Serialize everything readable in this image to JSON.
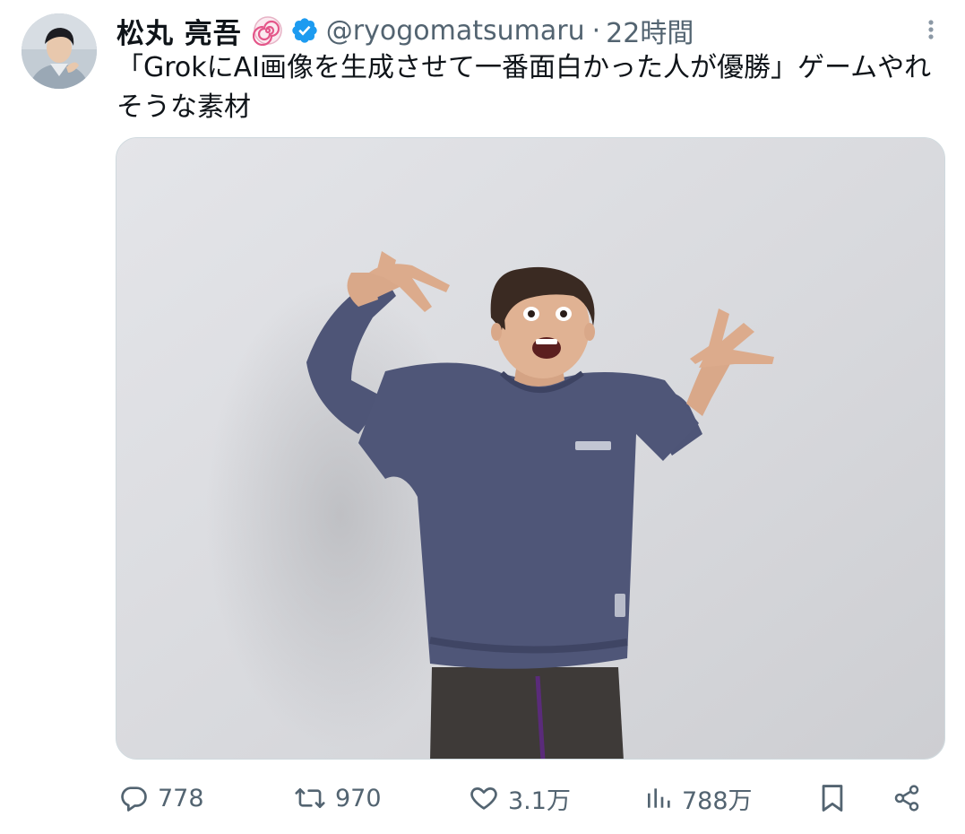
{
  "author": {
    "display_name": "松丸 亮吾",
    "handle": "@ryogomatsumaru",
    "separator": "·",
    "timestamp": "22時間"
  },
  "tweet": {
    "text": "「GrokにAI画像を生成させて一番面白かった人が優勝」ゲームやれそうな素材"
  },
  "media": {
    "description_icon": "photo"
  },
  "actions": {
    "reply_count": "778",
    "retweet_count": "970",
    "like_count": "3.1万",
    "view_count": "788万"
  },
  "colors": {
    "text_primary": "#0f1419",
    "text_secondary": "#536471",
    "verified_blue": "#1d9bf0"
  }
}
